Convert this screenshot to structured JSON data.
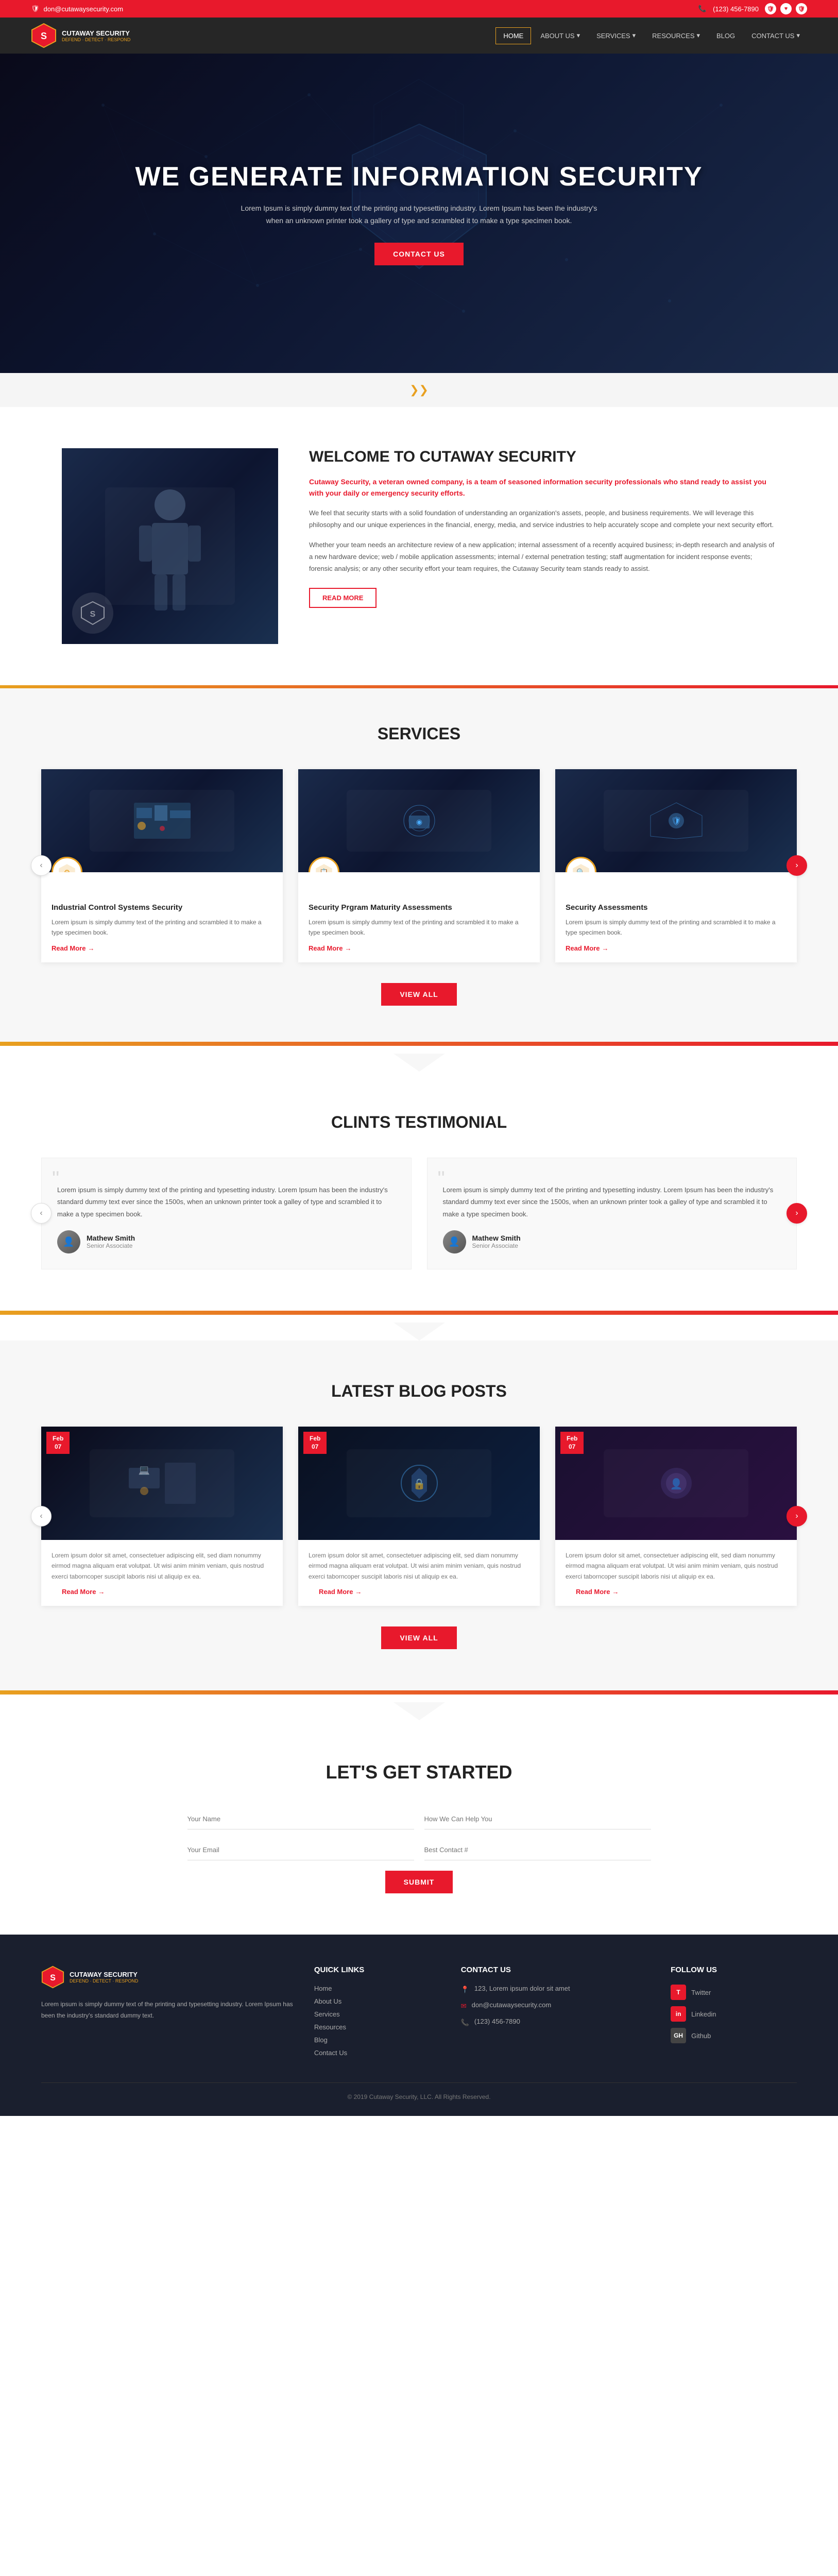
{
  "topbar": {
    "email": "don@cutawaysecurity.com",
    "phone": "(123) 456-7890",
    "icons": [
      "shield",
      "heart",
      "shield2"
    ]
  },
  "nav": {
    "logo_name": "CUTAWAY SECURITY",
    "logo_tagline": "DEFEND · DETECT · RESPOND",
    "items": [
      {
        "label": "HOME",
        "active": true
      },
      {
        "label": "ABOUT US",
        "active": false
      },
      {
        "label": "SERVICES",
        "active": false
      },
      {
        "label": "RESOURCES",
        "active": false
      },
      {
        "label": "BLOG",
        "active": false
      },
      {
        "label": "CONTACT US",
        "active": false
      }
    ]
  },
  "hero": {
    "title": "WE GENERATE INFORMATION SECURITY",
    "subtitle": "Lorem Ipsum is simply dummy text of the printing and typesetting industry. Lorem Ipsum has been the industry's when an unknown printer took a gallery of type and scrambled it to make a type specimen book.",
    "cta_button": "CONTACT US"
  },
  "welcome": {
    "title": "WELCOME TO CUTAWAY SECURITY",
    "highlight": "Cutaway Security, a veteran owned company, is a team of seasoned information security professionals who stand ready to assist you with your daily or emergency security efforts.",
    "text1": "We feel that security starts with a solid foundation of understanding an organization's assets, people, and business requirements. We will leverage this philosophy and our unique experiences in the financial, energy, media, and service industries to help accurately scope and complete your next security effort.",
    "text2": "Whether your team needs an architecture review of a new application; internal assessment of a recently acquired business; in-depth research and analysis of a new hardware device; web / mobile application assessments; internal / external penetration testing; staff augmentation for incident response events; forensic analysis; or any other security effort your team requires, the Cutaway Security team stands ready to assist.",
    "read_more": "READ MORE"
  },
  "services": {
    "title": "SERVICES",
    "view_all": "VIEW ALL",
    "items": [
      {
        "title": "Industrial Control Systems Security",
        "text": "Lorem ipsum is simply dummy text of the printing and scrambled it to make a type specimen book.",
        "read_more": "Read More"
      },
      {
        "title": "Security Prgram Maturity Assessments",
        "text": "Lorem ipsum is simply dummy text of the printing and scrambled it to make a type specimen book.",
        "read_more": "Read More"
      },
      {
        "title": "Security Assessments",
        "text": "Lorem ipsum is simply dummy text of the printing and scrambled it to make a type specimen book.",
        "read_more": "Read More"
      }
    ]
  },
  "testimonials": {
    "title": "CLINTS TESTIMONIAL",
    "items": [
      {
        "text": "Lorem ipsum is simply dummy text of the printing and typesetting industry. Lorem Ipsum has been the industry's standard dummy text ever since the 1500s, when an unknown printer took a galley of type and scrambled it to make a type specimen book.",
        "author": "Mathew Smith",
        "role": "Senior Associate"
      },
      {
        "text": "Lorem ipsum is simply dummy text of the printing and typesetting industry. Lorem Ipsum has been the industry's standard dummy text ever since the 1500s, when an unknown printer took a galley of type and scrambled it to make a type specimen book.",
        "author": "Mathew Smith",
        "role": "Senior Associate"
      }
    ]
  },
  "blog": {
    "title": "LATEST BLOG POSTS",
    "view_all": "VIEW ALL",
    "items": [
      {
        "date_month": "Feb",
        "date_day": "07",
        "text": "Lorem ipsum dolor sit amet, consectetuer adipiscing elit, sed diam nonummy eirmod magna aliquam erat volutpat. Ut wisi anim minim veniam, quis nostrud exerci taborncoper suscipit laboris nisi ut aliquip ex ea.",
        "read_more": "Read More"
      },
      {
        "date_month": "Feb",
        "date_day": "07",
        "text": "Lorem ipsum dolor sit amet, consectetuer adipiscing elit, sed diam nonummy eirmod magna aliquam erat volutpat. Ut wisi anim minim veniam, quis nostrud exerci taborncoper suscipit laboris nisi ut aliquip ex ea.",
        "read_more": "Read More"
      },
      {
        "date_month": "Feb",
        "date_day": "07",
        "text": "Lorem ipsum dolor sit amet, consectetuer adipiscing elit, sed diam nonummy eirmod magna aliquam erat volutpat. Ut wisi anim minim veniam, quis nostrud exerci taborncoper suscipit laboris nisi ut aliquip ex ea.",
        "read_more": "Read More"
      }
    ]
  },
  "cta": {
    "title": "LET'S GET STARTED",
    "fields": {
      "name": "Your Name",
      "help": "How We Can Help You",
      "email": "Your Email",
      "best_contact": "Best Contact #"
    },
    "submit": "SUBMIT"
  },
  "footer": {
    "logo_name": "CUTAWAY SECURITY",
    "logo_tagline": "DEFEND · DETECT · RESPOND",
    "description": "Lorem ipsum is simply dummy text of the printing and typesetting industry. Lorem Ipsum has been the industry's standard dummy text.",
    "quick_links": {
      "title": "QUICK LINKS",
      "items": [
        "Home",
        "About Us",
        "Services",
        "Resources",
        "Blog",
        "Contact Us"
      ]
    },
    "contact": {
      "title": "CONTACT US",
      "address": "123, Lorem ipsum dolor sit amet",
      "email": "don@cutawaysecurity.com",
      "phone": "(123) 456-7890"
    },
    "social": {
      "title": "FOLLOW US",
      "items": [
        "Twitter",
        "Linkedin",
        "Github"
      ]
    },
    "copyright": "© 2019 Cutaway Security, LLC. All Rights Reserved."
  }
}
